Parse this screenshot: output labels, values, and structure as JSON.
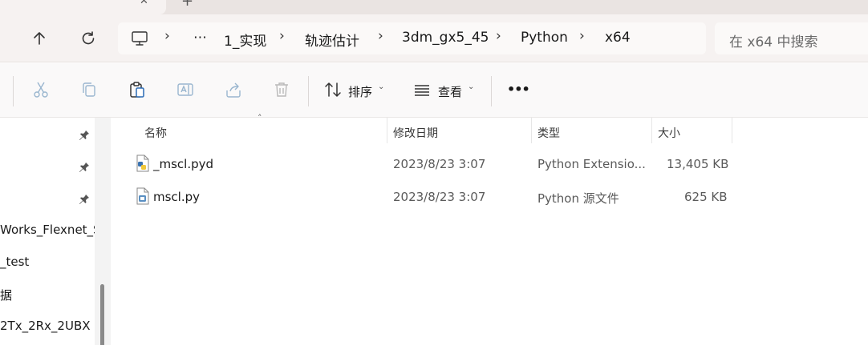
{
  "tabs": {
    "close_glyph": "✕",
    "new_tab_glyph": "+"
  },
  "navigation": {
    "breadcrumb": {
      "overflow": "⋯",
      "items": [
        "1_实现",
        "轨迹估计",
        "3dm_gx5_45",
        "Python",
        "x64"
      ],
      "separator": "›"
    },
    "search_placeholder": "在 x64 中搜索"
  },
  "toolbar": {
    "sort_label": "排序",
    "view_label": "查看",
    "more_glyph": "•••",
    "caret": "⌄"
  },
  "sidebar": {
    "items": [
      "Works_Flexnet_S",
      "_test",
      "据",
      "2Tx_2Rx_2UBX"
    ]
  },
  "filelist": {
    "columns": {
      "name": "名称",
      "modified": "修改日期",
      "type": "类型",
      "size": "大小"
    },
    "sort_indicator": "˄",
    "rows": [
      {
        "name": "_mscl.pyd",
        "modified": "2023/8/23 3:07",
        "type": "Python Extensio...",
        "size": "13,405 KB",
        "icon": "python-extension-icon"
      },
      {
        "name": "mscl.py",
        "modified": "2023/8/23 3:07",
        "type": "Python 源文件",
        "size": "625 KB",
        "icon": "python-file-icon"
      }
    ]
  },
  "colors": {
    "chrome_bg": "#f6f2f1",
    "tab_strip_bg": "#eae4e2",
    "toolbar_bg": "#faf9f9",
    "content_bg": "#ffffff"
  }
}
